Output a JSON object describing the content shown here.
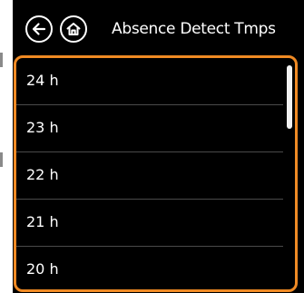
{
  "header": {
    "title": "Absence Detect Tmps",
    "back_icon": "arrow-left-icon",
    "home_icon": "home-icon"
  },
  "list": {
    "items": [
      {
        "label": "24 h"
      },
      {
        "label": "23 h"
      },
      {
        "label": "22 h"
      },
      {
        "label": "21 h"
      },
      {
        "label": "20 h"
      }
    ],
    "selection_color": "#f08a24",
    "scroll_position": 0
  },
  "colors": {
    "background": "#000000",
    "text": "#ffffff",
    "accent": "#f08a24",
    "divider": "#4a4a4a"
  }
}
